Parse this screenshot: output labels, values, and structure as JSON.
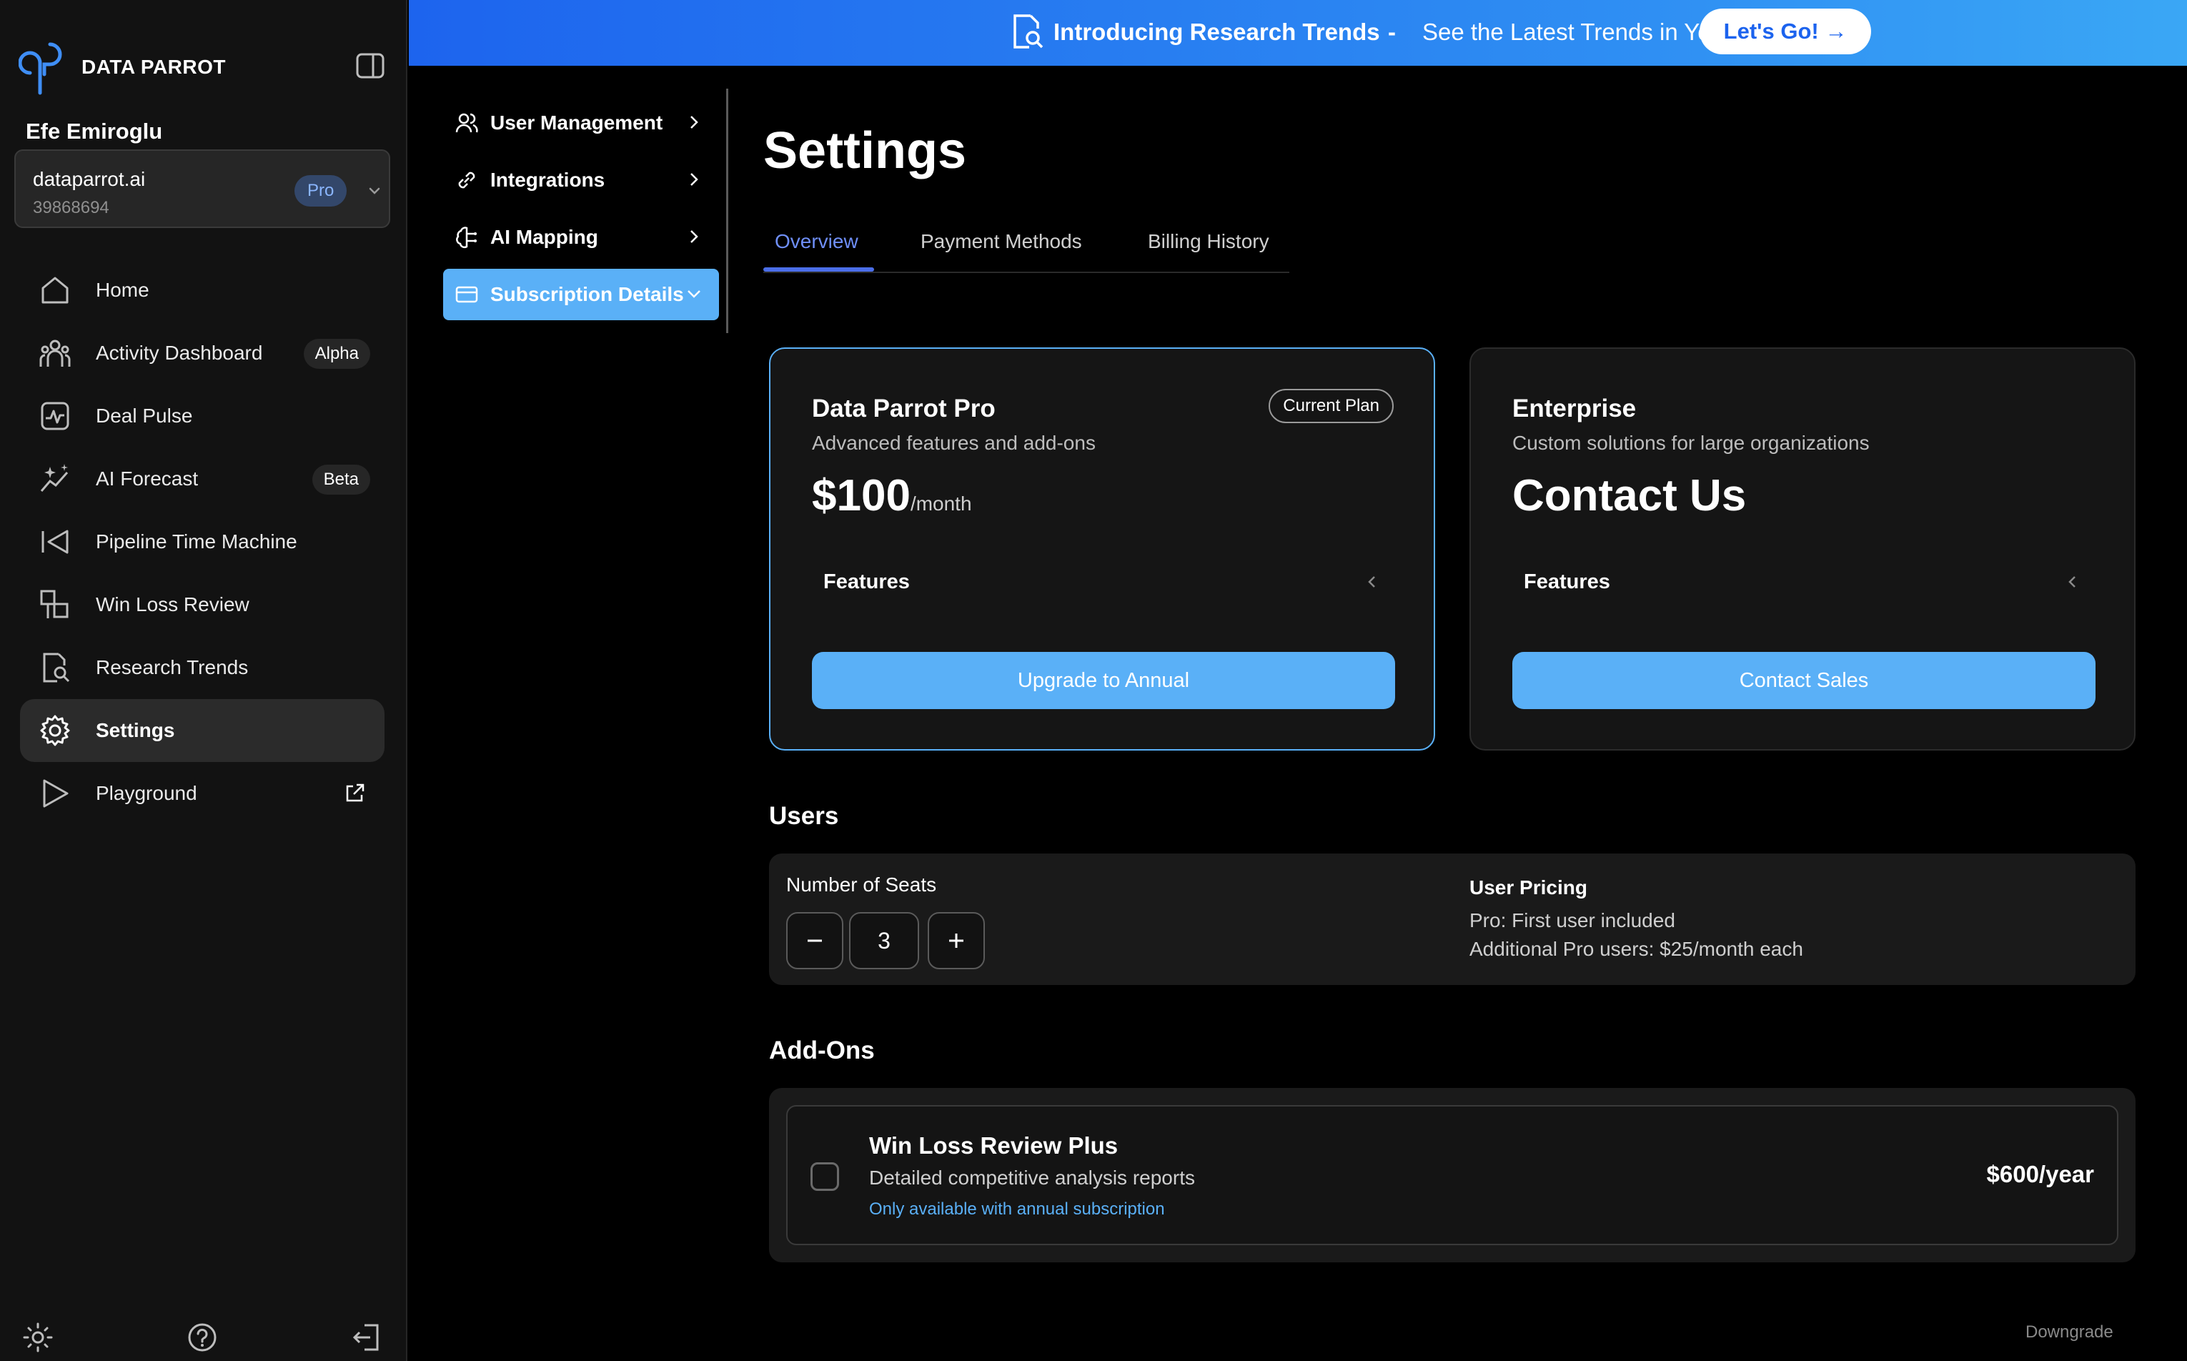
{
  "brand": {
    "name": "DATA PARROT",
    "accent": "#5ab0f7"
  },
  "user": {
    "name": "Efe Emiroglu"
  },
  "org": {
    "name": "dataparrot.ai",
    "id": "39868694",
    "plan_badge": "Pro"
  },
  "sidebar": {
    "items": [
      {
        "label": "Home",
        "icon": "home-icon"
      },
      {
        "label": "Activity Dashboard",
        "icon": "users-icon",
        "badge": "Alpha"
      },
      {
        "label": "Deal Pulse",
        "icon": "pulse-icon"
      },
      {
        "label": "AI Forecast",
        "icon": "sparkle-icon",
        "badge": "Beta"
      },
      {
        "label": "Pipeline Time Machine",
        "icon": "rewind-icon"
      },
      {
        "label": "Win Loss Review",
        "icon": "compare-icon"
      },
      {
        "label": "Research Trends",
        "icon": "document-search-icon"
      },
      {
        "label": "Settings",
        "icon": "gear-icon",
        "active": true
      },
      {
        "label": "Playground",
        "icon": "play-icon"
      }
    ]
  },
  "banner": {
    "title": "Introducing Research Trends",
    "separator": "-",
    "subtitle": "See the Latest Trends in Your Deals",
    "cta": "Let's Go! →"
  },
  "settings_nav": {
    "items": [
      {
        "label": "User Management",
        "icon": "users-icon"
      },
      {
        "label": "Integrations",
        "icon": "link-icon"
      },
      {
        "label": "AI Mapping",
        "icon": "brain-icon"
      },
      {
        "label": "Subscription Details",
        "icon": "card-icon",
        "active": true
      }
    ]
  },
  "page": {
    "title": "Settings"
  },
  "tabs": [
    {
      "label": "Overview",
      "active": true
    },
    {
      "label": "Payment Methods"
    },
    {
      "label": "Billing History"
    }
  ],
  "plans": [
    {
      "name": "Data Parrot Pro",
      "description": "Advanced features and add-ons",
      "price": "$100",
      "period": "/month",
      "badge": "Current Plan",
      "features_label": "Features",
      "button": "Upgrade to Annual"
    },
    {
      "name": "Enterprise",
      "description": "Custom solutions for large organizations",
      "price": "Contact Us",
      "features_label": "Features",
      "button": "Contact Sales"
    }
  ],
  "users_section": {
    "title": "Users",
    "seats_label": "Number of Seats",
    "seats_value": "3",
    "minus": "−",
    "plus": "+",
    "pricing_title": "User Pricing",
    "pricing_lines": [
      "Pro: First user included",
      "Additional Pro users: $25/month each"
    ]
  },
  "addons_section": {
    "title": "Add-Ons",
    "items": [
      {
        "name": "Win Loss Review Plus",
        "description": "Detailed competitive analysis reports",
        "note": "Only available with annual subscription",
        "price": "$600/year"
      }
    ]
  },
  "footer": {
    "downgrade": "Downgrade"
  }
}
